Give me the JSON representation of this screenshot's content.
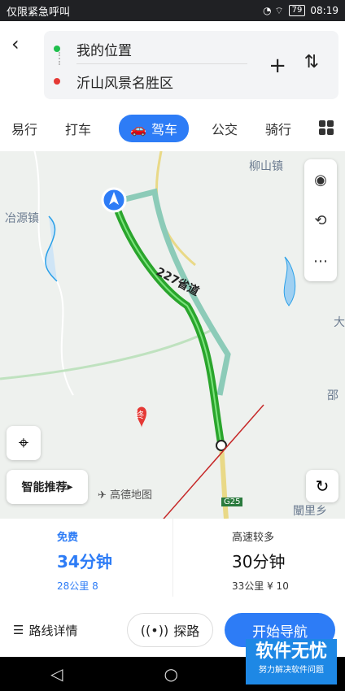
{
  "status": {
    "left": "仅限紧急呼叫",
    "battery": "79",
    "time": "08:19"
  },
  "route_inputs": {
    "from": "我的位置",
    "to": "沂山风景名胜区"
  },
  "modes": [
    "易行",
    "打车",
    "驾车",
    "公交",
    "骑行"
  ],
  "active_mode": "驾车",
  "map": {
    "labels": [
      "柳山镇",
      "冶源镇",
      "邵",
      "闡里乡",
      "大",
      "终"
    ],
    "road_label": "227省道",
    "brand": "高德地图",
    "road_sign": "G25",
    "smart_label": "智能推荐"
  },
  "routes": [
    {
      "tag": "免费",
      "time": "34分钟",
      "distance": "28公里",
      "extra": "8"
    },
    {
      "tag": "高速较多",
      "time": "30分钟",
      "distance": "33公里",
      "extra": "¥ 10"
    }
  ],
  "actions": {
    "detail": "路线详情",
    "probe": "探路",
    "start": "开始导航"
  },
  "watermark": {
    "title": "软件无忧",
    "sub": "努力解决软件问题"
  },
  "colors": {
    "accent": "#2d7cf6",
    "route": "#2aa52c",
    "alt_route": "#8ccbb8"
  }
}
